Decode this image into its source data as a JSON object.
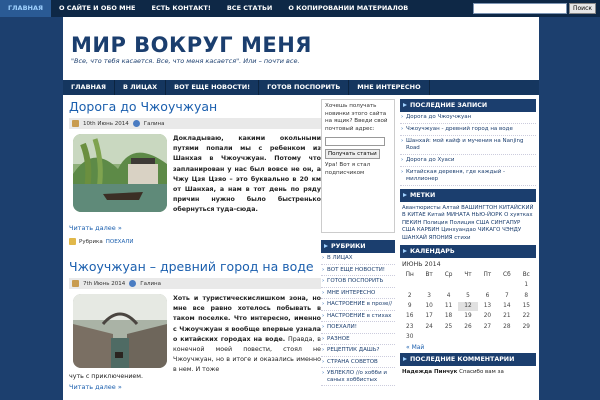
{
  "topnav": {
    "items": [
      "ГЛАВНАЯ",
      "О САЙТЕ И ОБО МНЕ",
      "ЕСТЬ КОНТАКТ!",
      "ВСЕ СТАТЬИ",
      "О КОПИРОВАНИИ МАТЕРИАЛОВ"
    ],
    "search_button": "Поиск"
  },
  "header": {
    "title": "МИР ВОКРУГ МЕНЯ",
    "tagline": "\"Все, что тебя касается. Все, что меня касается\". Или – почти все."
  },
  "mainnav": {
    "items": [
      "ГЛАВНАЯ",
      "В ЛИЦАХ",
      "ВОТ ЕЩЕ НОВОСТИ!",
      "ГОТОВ ПОСПОРИТЬ",
      "МНЕ ИНТЕРЕСНО"
    ]
  },
  "posts": [
    {
      "title": "Дорога до Чжоучжуан",
      "date": "10th Июнь 2014",
      "author": "Галина",
      "text": "Докладываю, какими окольными путями попали мы с ребенком из Шанхая в Чжоучжуан. Потому что запланирован у нас был вовсе не он, а Чжу Цзя Цзяо – это буквально в 20 км от Шанхая, а нам в тот день по ряду причин нужно было быстренько обернуться туда-сюда.",
      "readmore": "Читать далее »",
      "rubric_label": "Рубрика",
      "rubric": "ПОЕХАЛИ"
    },
    {
      "title": "Чжоучжуан – древний город на воде",
      "date": "7th Июнь 2014",
      "author": "Галина",
      "text_bold": "Хоть и туристическиcлишком зона, но мне все равно хотелось побывать в таком поселке. Что интересно, именно с Чжоучжуан я вообще впервые узнала о китайских городах на воде.",
      "text_rest": "Правда, в конечной моей повести, стоял не Чжоучжуан, но в итоге и оказались именно в нем. И тоже",
      "tail": "чуть с приключением.",
      "readmore": "Читать далее »"
    }
  ],
  "subscribe": {
    "text": "Хочешь получать новинки этого сайта на ящик? Введи свой почтовый адрес:",
    "button": "Получать статьи",
    "note": "Ура! Вот я стал подписчиком"
  },
  "rubrics": {
    "title": "РУБРИКИ",
    "items": [
      "В ЛИЦАХ",
      "ВОТ ЕЩЕ НОВОСТИ!",
      "ГОТОВ ПОСПОРИТЬ",
      "МНЕ ИНТЕРЕСНО",
      "НАСТРОЕНИЕ в прозе//",
      "НАСТРОЕНИЕ в стихах",
      "ПОЕХАЛИ!",
      "РАЗНОЕ",
      "РЕЦЕПТИК ДАШЬ?",
      "СТРАНА СОВЕТОВ",
      "УВЛЕКЛО //о хобби и саных хоббистых"
    ]
  },
  "recent": {
    "title": "ПОСЛЕДНИЕ ЗАПИСИ",
    "items": [
      "Дорога до Чжоучжуан",
      "Чжоучжуан - древний город на воде",
      "Шанхай: мой кайф и мучения на Nanjing Road",
      "Дорога до Хуаси",
      "Китайская деревня, где каждый - миллионер"
    ]
  },
  "tags": {
    "title": "МЕТКИ",
    "text": "Авантюристы Алтай ВАШИНГТОН КИТАЙСКИЙ В КИТАЕ Китай МИНАТА НЬЮ-ЙОРК О хуятках ПЕКИН Полиция Полиция США СИНГАПУР США КАРБИН Цинхуандао ЧИКАГО ЧЭНДУ ШАНХАЙ ЯПОНИЯ стихи"
  },
  "calendar": {
    "title": "КАЛЕНДАРЬ",
    "caption": "ИЮНЬ 2014",
    "headers": [
      "Пн",
      "Вт",
      "Ср",
      "Чт",
      "Пт",
      "Сб",
      "Вс"
    ],
    "days": [
      "",
      "",
      "",
      "",
      "",
      "",
      "1",
      "2",
      "3",
      "4",
      "5",
      "6",
      "7",
      "8",
      "9",
      "10",
      "11",
      "12",
      "13",
      "14",
      "15",
      "16",
      "17",
      "18",
      "19",
      "20",
      "21",
      "22",
      "23",
      "24",
      "25",
      "26",
      "27",
      "28",
      "29",
      "30"
    ],
    "prev": "« Май"
  },
  "comments": {
    "title": "ПОСЛЕДНИЕ КОММЕНТАРИИ",
    "author": "Надежда Пинчук",
    "text": "Спасибо вам за"
  }
}
